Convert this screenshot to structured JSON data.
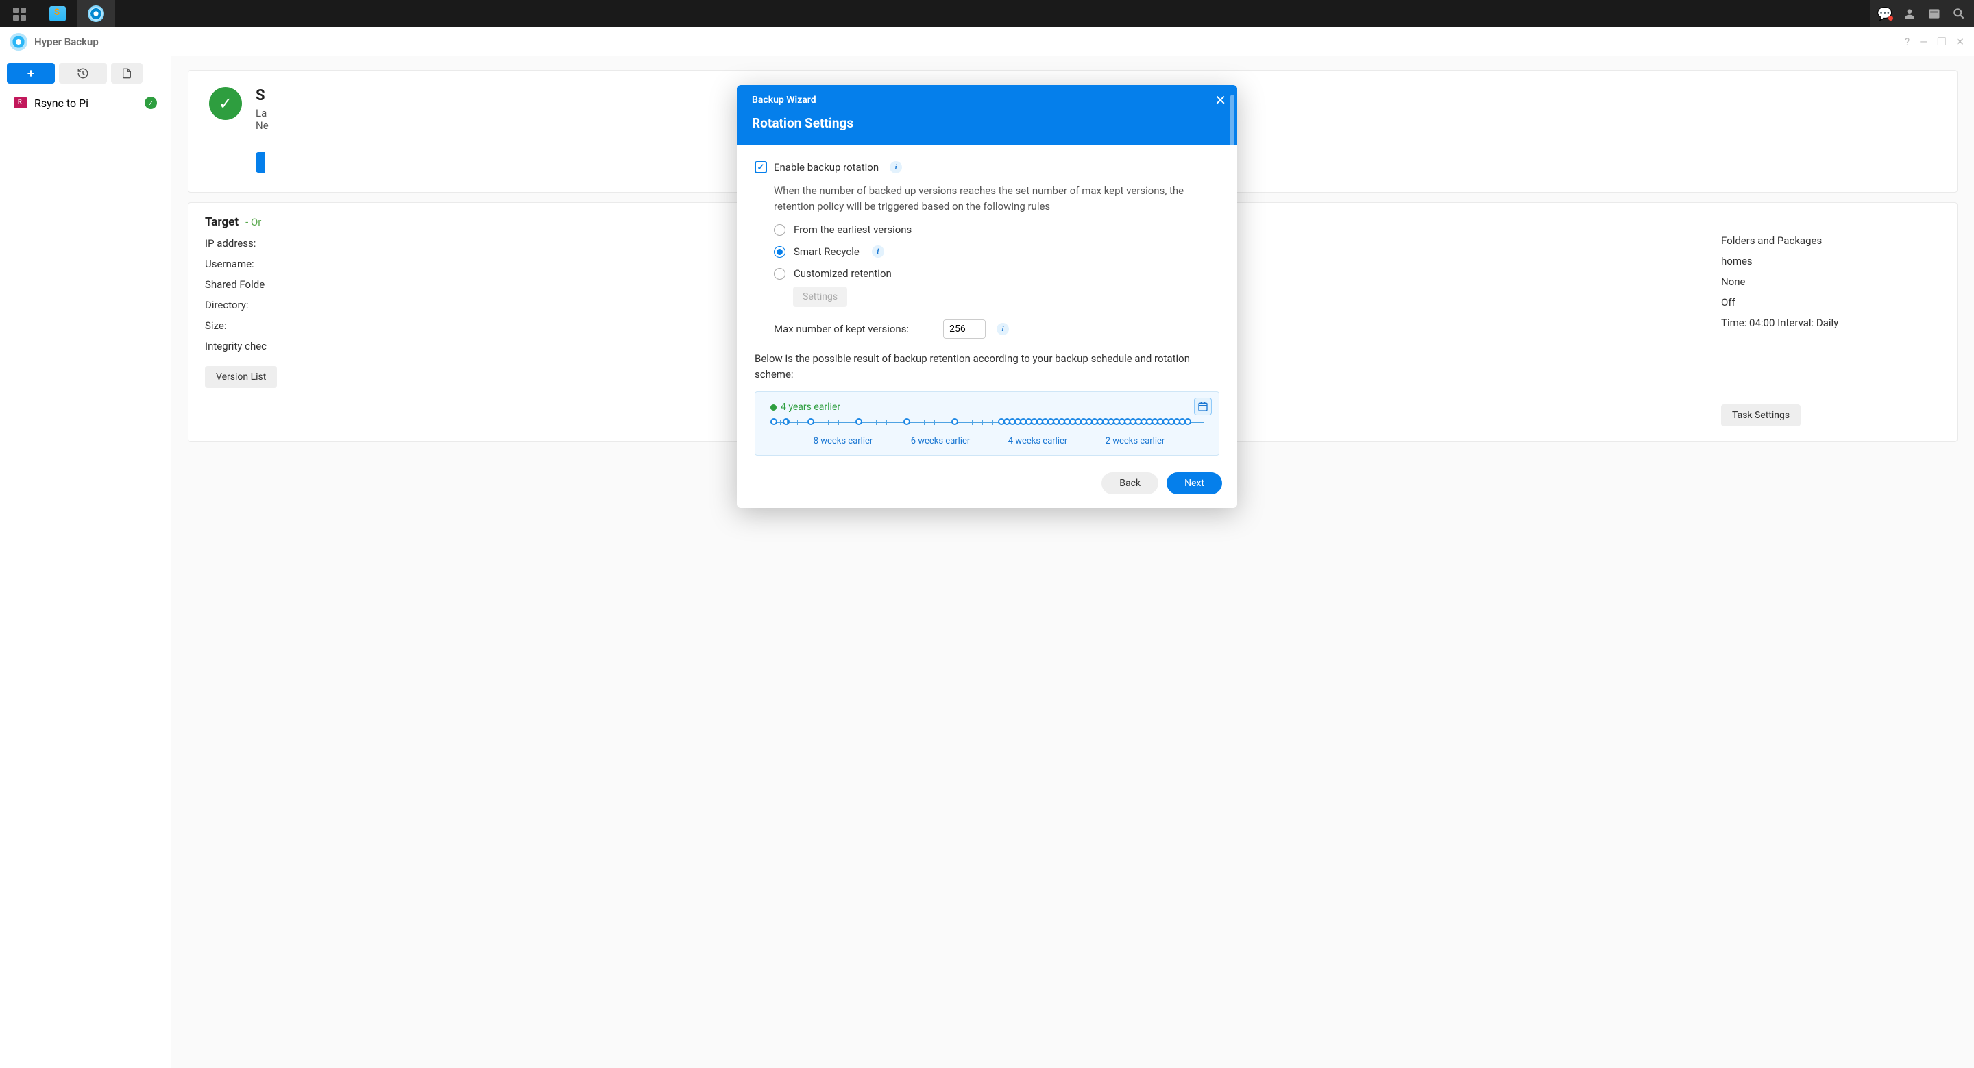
{
  "app": {
    "title": "Hyper Backup"
  },
  "sidebar": {
    "task": {
      "name": "Rsync to Pi"
    }
  },
  "status": {
    "title_initial": "S",
    "last_prefix": "La",
    "next_prefix": "Ne"
  },
  "details": {
    "target_label": "Target",
    "target_status": "- Or",
    "fields": {
      "ip": "IP address:",
      "user": "Username:",
      "shared": "Shared Folde",
      "dir": "Directory:",
      "size": "Size:",
      "integrity": "Integrity chec"
    },
    "right": {
      "folders": "Folders and Packages",
      "homes": "homes",
      "none": "None",
      "off": "Off",
      "time": "Time: 04:00 Interval: Daily"
    },
    "version_list": "Version List",
    "task_settings": "Task Settings"
  },
  "modal": {
    "wizard": "Backup Wizard",
    "title": "Rotation Settings",
    "enable": "Enable backup rotation",
    "desc": "When the number of backed up versions reaches the set number of max kept versions, the retention policy will be triggered based on the following rules",
    "opt_earliest": "From the earliest versions",
    "opt_smart": "Smart Recycle",
    "opt_custom": "Customized retention",
    "settings_btn": "Settings",
    "max_label": "Max number of kept versions:",
    "max_value": "256",
    "below": "Below is the possible result of backup retention according to your backup schedule and rotation scheme:",
    "timeline": {
      "start": "4 years earlier",
      "labels": {
        "w8": "8 weeks earlier",
        "w6": "6 weeks earlier",
        "w4": "4 weeks earlier",
        "w2": "2 weeks earlier"
      }
    },
    "back": "Back",
    "next": "Next"
  }
}
